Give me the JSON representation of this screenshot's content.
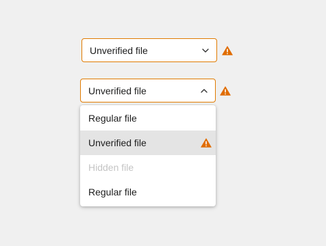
{
  "select_closed": {
    "value": "Unverified file",
    "icon": "chevron-down-icon",
    "warning_icon": "warning-icon"
  },
  "select_open": {
    "value": "Unverified file",
    "icon": "chevron-up-icon",
    "warning_icon": "warning-icon"
  },
  "menu": {
    "items": [
      {
        "label": "Regular file",
        "state": "normal"
      },
      {
        "label": "Unverified file",
        "state": "selected",
        "icon": "warning-icon"
      },
      {
        "label": "Hidden file",
        "state": "disabled"
      },
      {
        "label": "Regular file",
        "state": "normal"
      }
    ]
  },
  "colors": {
    "accent": "#e07a00",
    "warning": "#e06c00",
    "selected_bg": "#e4e4e4",
    "disabled_text": "#c4c4c4",
    "background": "#f0f0f0"
  }
}
